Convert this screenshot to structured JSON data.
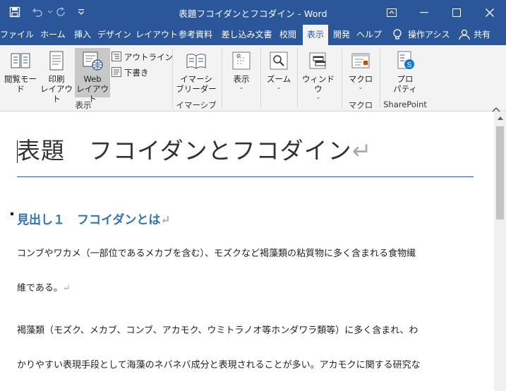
{
  "titlebar": {
    "title": "表題フコイダンとフコダイン  -  Word",
    "icons": [
      "save-icon",
      "undo-icon",
      "redo-icon",
      "customize-qat-icon",
      "ribbon-display-icon",
      "minimize-icon",
      "maximize-icon",
      "close-icon"
    ]
  },
  "tabs": [
    {
      "label": "ファイル"
    },
    {
      "label": "ホーム"
    },
    {
      "label": "挿入"
    },
    {
      "label": "デザイン"
    },
    {
      "label": "レイアウト"
    },
    {
      "label": "参考資料"
    },
    {
      "label": "差し込み文書"
    },
    {
      "label": "校閲"
    },
    {
      "label": "表示",
      "active": true
    },
    {
      "label": "開発"
    },
    {
      "label": "ヘルプ"
    },
    {
      "label": "操作アシス"
    },
    {
      "label": "共有"
    }
  ],
  "ribbon": {
    "views": {
      "read_mode": "閲覧モード",
      "print_layout_1": "印刷",
      "print_layout_2": "レイアウト",
      "web_layout_1": "Web",
      "web_layout_2": "レイアウト",
      "outline": "アウトライン",
      "draft": "下書き",
      "group": "表示"
    },
    "immersive": {
      "reader_1": "イマーシ",
      "reader_2": "ブリーダー",
      "group": "イマーシブ"
    },
    "show": "表示",
    "zoom": "ズーム",
    "window": "ウィンドウ",
    "macros": {
      "label": "マクロ",
      "group": "マクロ"
    },
    "sharepoint": {
      "label_1": "プロ",
      "label_2": "パティ",
      "group": "SharePoint"
    }
  },
  "document": {
    "title": "表題　フコイダンとフコダイン",
    "heading1": "見出し１　フコイダンとは",
    "para1_line1": "コンブやワカメ（一部位であるメカブを含む）、モズクなど褐藻類の粘質物に多く含まれる食物繊",
    "para1_line2": "維である。",
    "para2_line1": "褐藻類（モズク、メカブ、コンブ、アカモク、ウミトラノオ等ホンダワラ類等）に多く含まれ、わ",
    "para2_line2": "かりやすい表現手段として海藻のネバネバ成分と表現されることが多い。アカモクに関する研究な",
    "pilcrow": "↵"
  },
  "colors": {
    "accent": "#2b579a",
    "ribbon_bg": "#f3f3f3",
    "heading": "#2e74b5",
    "rule": "#2e5f8c"
  }
}
